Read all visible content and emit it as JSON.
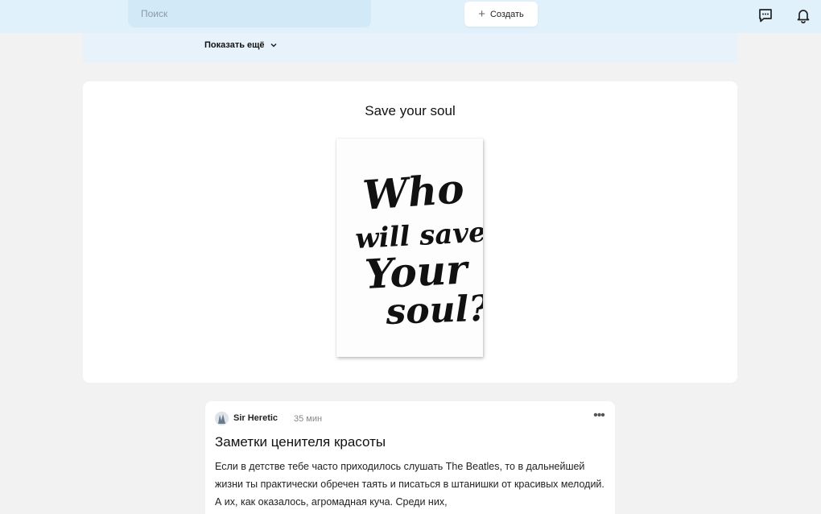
{
  "header": {
    "search_placeholder": "Поиск",
    "create_label": "Создать",
    "icons": [
      "messages-icon",
      "bell-icon"
    ]
  },
  "strip": {
    "show_more_label": "Показать ещё"
  },
  "featured": {
    "title": "Save your soul",
    "poster_text": [
      "Who",
      "will save",
      "Your",
      "soul?"
    ]
  },
  "post": {
    "author": "Sir Heretic",
    "time": "35 мин",
    "title": "Заметки ценителя красоты",
    "text": "Если в детстве тебе часто приходилось слушать The Beatles, то в дальнейшей жизни ты практически обречен таять и писаться в штанишки от красивых мелодий. А их, как оказалось, агромадная куча. Среди них,"
  },
  "colors": {
    "topbar_bg": "#e1f1fb",
    "search_bg": "#d2e9f8",
    "page_bg": "#f2f2f2"
  }
}
